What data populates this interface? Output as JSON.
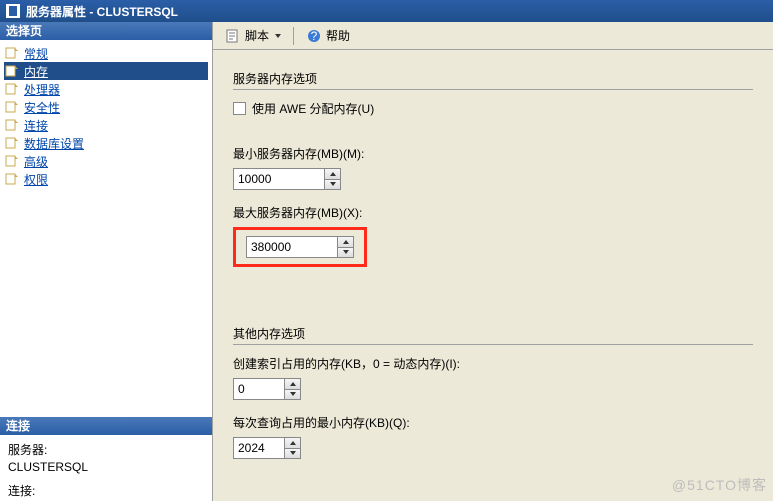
{
  "window": {
    "title": "服务器属性 - CLUSTERSQL"
  },
  "toolbar": {
    "script_label": "脚本",
    "help_label": "帮助"
  },
  "sidebar": {
    "header_select": "选择页",
    "items": [
      {
        "label": "常规"
      },
      {
        "label": "内存"
      },
      {
        "label": "处理器"
      },
      {
        "label": "安全性"
      },
      {
        "label": "连接"
      },
      {
        "label": "数据库设置"
      },
      {
        "label": "高级"
      },
      {
        "label": "权限"
      }
    ],
    "header_conn": "连接",
    "server_label": "服务器:",
    "server_value": "CLUSTERSQL",
    "conn_label": "连接:"
  },
  "content": {
    "section1_title": "服务器内存选项",
    "awe_label": "使用 AWE 分配内存(U)",
    "min_mem_label": "最小服务器内存(MB)(M):",
    "min_mem_value": "10000",
    "max_mem_label": "最大服务器内存(MB)(X):",
    "max_mem_value": "380000",
    "section2_title": "其他内存选项",
    "index_mem_label": "创建索引占用的内存(KB，0 = 动态内存)(I):",
    "index_mem_value": "0",
    "query_mem_label": "每次查询占用的最小内存(KB)(Q):",
    "query_mem_value": "2024"
  },
  "watermark": "@51CTO博客"
}
